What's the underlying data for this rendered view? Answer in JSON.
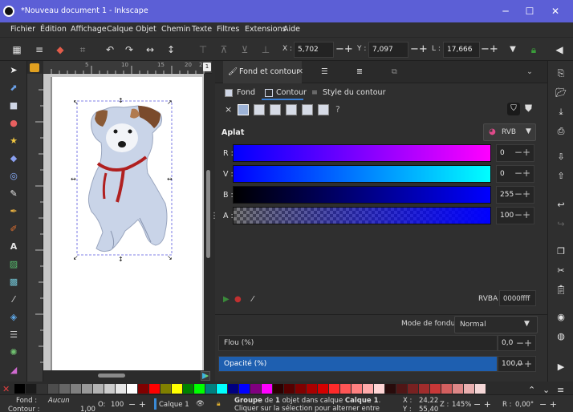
{
  "window": {
    "title": "*Nouveau document 1 - Inkscape",
    "minimize": "─",
    "maximize": "☐",
    "close": "✕"
  },
  "menu": [
    "Fichier",
    "Édition",
    "Affichage",
    "Calque",
    "Objet",
    "Chemin",
    "Texte",
    "Filtres",
    "Extensions",
    "Aide"
  ],
  "toolbar": {
    "x_label": "X :",
    "x_value": "5,702",
    "y_label": "Y :",
    "y_value": "7,097",
    "w_label": "L :",
    "w_value": "17,666"
  },
  "ruler": {
    "ticks": [
      "5",
      "10",
      "15",
      "20",
      "25"
    ],
    "page_badge": "1"
  },
  "dock": {
    "tab_fill_stroke": "Fond et contour",
    "subtab_fill": "Fond",
    "subtab_stroke": "Contour",
    "subtab_stroke_style": "Style du contour",
    "flat_label": "Aplat",
    "mode": "RVB",
    "channels": [
      {
        "label": "R :",
        "value": "0"
      },
      {
        "label": "V :",
        "value": "0"
      },
      {
        "label": "B :",
        "value": "255"
      },
      {
        "label": "A :",
        "value": "100"
      }
    ],
    "rgba_label": "RVBA :",
    "rgba_value": "0000ffff",
    "blend_label": "Mode de fondu :",
    "blend_value": "Normal",
    "blur_label": "Flou (%)",
    "blur_value": "0,0",
    "opacity_label": "Opacité (%)",
    "opacity_value": "100,0"
  },
  "status": {
    "fill_label": "Fond :",
    "fill_value": "Aucun",
    "stroke_label": "Contour :",
    "stroke_width": "1,00",
    "o_label": "O:",
    "o_value": "100",
    "layer": "Calque 1",
    "message_bold": "Groupe",
    "message_1": " de ",
    "message_bold2": "1",
    "message_2": " objet dans calque ",
    "message_bold3": "Calque 1",
    "message_3": ". Cliquer sur la sélection pour alterner entre poignées de redimensio...",
    "x_label": "X :",
    "x_value": "24,22",
    "y_label": "Y :",
    "y_value": "55,40",
    "zoom_label": "Z :",
    "zoom_value": "145%",
    "rot_label": "R :",
    "rot_value": "0,00°"
  },
  "colors": {
    "titlebar": "#5c5fd6",
    "selected_blue": "#1e5fb0",
    "stroke_blue": "#0000ff"
  }
}
